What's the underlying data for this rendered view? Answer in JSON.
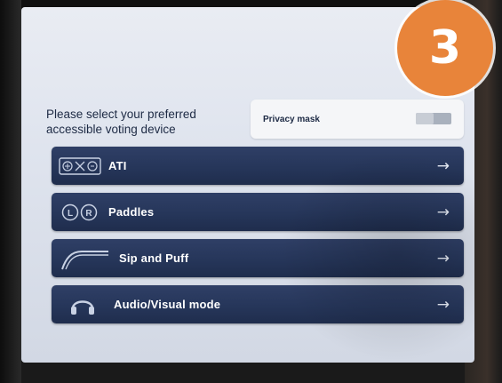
{
  "step_badge": "3",
  "prompt": {
    "line1": "Please select your preferred",
    "line2": "accessible voting device"
  },
  "privacy_mask": {
    "label": "Privacy mask"
  },
  "devices": [
    {
      "label": "ATI",
      "icon": "ati-keypad-icon",
      "arrow": "→"
    },
    {
      "label": "Paddles",
      "icon": "paddles-icon",
      "arrow": "→"
    },
    {
      "label": "Sip and Puff",
      "icon": "sip-puff-tube-icon",
      "arrow": "→"
    },
    {
      "label": "Audio/Visual mode",
      "icon": "headphones-icon",
      "arrow": "→"
    }
  ],
  "colors": {
    "badge": "#e8843a",
    "button": "#26365a",
    "screen": "#dfe4ee"
  }
}
